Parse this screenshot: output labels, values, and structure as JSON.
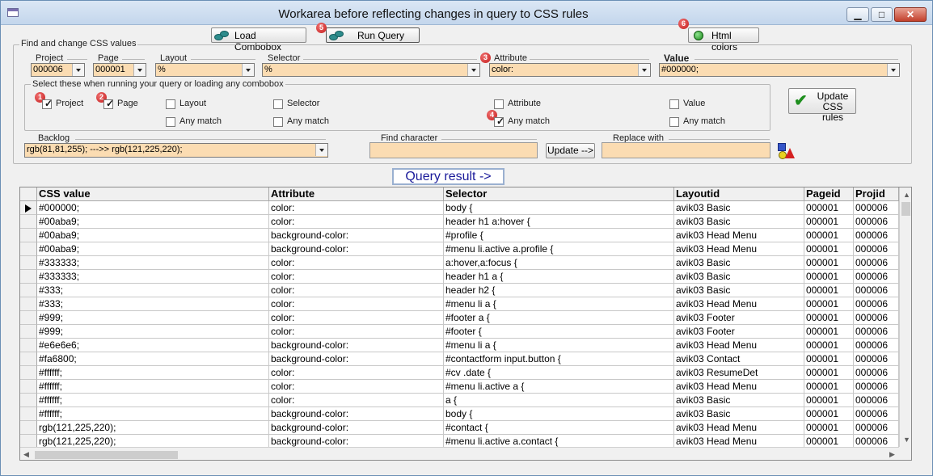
{
  "window": {
    "title": "Workarea before reflecting changes in query to CSS rules",
    "controls": {
      "minimize": "▁",
      "maximize": "□",
      "close": "✕"
    }
  },
  "toolbar": {
    "load_combobox": "Load Combobox",
    "run_query": "Run Query",
    "html_colors": "Html colors"
  },
  "badges": [
    "1",
    "2",
    "3",
    "4",
    "5",
    "6"
  ],
  "find_group": {
    "legend": "Find and change CSS values",
    "fields": {
      "project": {
        "label": "Project",
        "value": "000006"
      },
      "page": {
        "label": "Page",
        "value": "000001"
      },
      "layout": {
        "label": "Layout",
        "value": "%"
      },
      "selector": {
        "label": "Selector",
        "value": "%"
      },
      "attribute": {
        "label": "Attribute",
        "value": "color:"
      },
      "value": {
        "label": "Value",
        "value": "#000000;"
      }
    },
    "select_group": {
      "legend": "Select these when running your query or loading any combobox",
      "project": {
        "label": "Project",
        "checked": true
      },
      "page": {
        "label": "Page",
        "checked": true
      },
      "layout": {
        "label": "Layout",
        "checked": false
      },
      "layout_any": {
        "label": "Any match",
        "checked": false
      },
      "selector": {
        "label": "Selector",
        "checked": false
      },
      "selector_any": {
        "label": "Any match",
        "checked": false
      },
      "attribute": {
        "label": "Attribute",
        "checked": false
      },
      "attribute_any": {
        "label": "Any match",
        "checked": true
      },
      "value": {
        "label": "Value",
        "checked": false
      },
      "value_any": {
        "label": "Any match",
        "checked": false
      }
    },
    "update_css": {
      "line1": "Update",
      "line2": "CSS rules"
    },
    "backlog": {
      "label": "Backlog",
      "value": "rgb(81,81,255); --->> rgb(121,225,220);"
    },
    "find_character": {
      "label": "Find character",
      "value": ""
    },
    "update_arrow": "Update -->",
    "replace_with": {
      "label": "Replace with",
      "value": ""
    }
  },
  "query_result_label": "Query result   ->",
  "table": {
    "columns": [
      "CSS value",
      "Attribute",
      "Selector",
      "Layoutid",
      "Pageid",
      "Projid"
    ],
    "rows": [
      [
        "#000000;",
        "color:",
        "body {",
        "avik03  Basic",
        "000001",
        "000006"
      ],
      [
        "#00aba9;",
        "color:",
        "header h1 a:hover {",
        "avik03  Basic",
        "000001",
        "000006"
      ],
      [
        "#00aba9;",
        "background-color:",
        "#profile {",
        "avik03  Head  Menu",
        "000001",
        "000006"
      ],
      [
        "#00aba9;",
        "background-color:",
        "#menu li.active a.profile {",
        "avik03  Head  Menu",
        "000001",
        "000006"
      ],
      [
        "#333333;",
        "color:",
        "a:hover,a:focus {",
        "avik03  Basic",
        "000001",
        "000006"
      ],
      [
        "#333333;",
        "color:",
        "header h1 a {",
        "avik03  Basic",
        "000001",
        "000006"
      ],
      [
        "#333;",
        "color:",
        "header h2 {",
        "avik03  Basic",
        "000001",
        "000006"
      ],
      [
        "#333;",
        "color:",
        "#menu li a {",
        "avik03  Head  Menu",
        "000001",
        "000006"
      ],
      [
        "#999;",
        "color:",
        "#footer a {",
        "avik03  Footer",
        "000001",
        "000006"
      ],
      [
        "#999;",
        "color:",
        "#footer {",
        "avik03  Footer",
        "000001",
        "000006"
      ],
      [
        "#e6e6e6;",
        "background-color:",
        "#menu li a {",
        "avik03  Head  Menu",
        "000001",
        "000006"
      ],
      [
        "#fa6800;",
        "background-color:",
        "#contactform input.button {",
        "avik03  Contact",
        "000001",
        "000006"
      ],
      [
        "#ffffff;",
        "color:",
        "#cv .date {",
        "avik03  ResumeDet",
        "000001",
        "000006"
      ],
      [
        "#ffffff;",
        "color:",
        "#menu li.active a {",
        "avik03  Head  Menu",
        "000001",
        "000006"
      ],
      [
        "#ffffff;",
        "color:",
        "a {",
        "avik03  Basic",
        "000001",
        "000006"
      ],
      [
        "#ffffff;",
        "background-color:",
        "body {",
        "avik03  Basic",
        "000001",
        "000006"
      ],
      [
        "rgb(121,225,220);",
        "background-color:",
        "#contact {",
        "avik03  Head  Menu",
        "000001",
        "000006"
      ],
      [
        "rgb(121,225,220);",
        "background-color:",
        "#menu li.active a.contact {",
        "avik03  Head  Menu",
        "000001",
        "000006"
      ]
    ]
  }
}
